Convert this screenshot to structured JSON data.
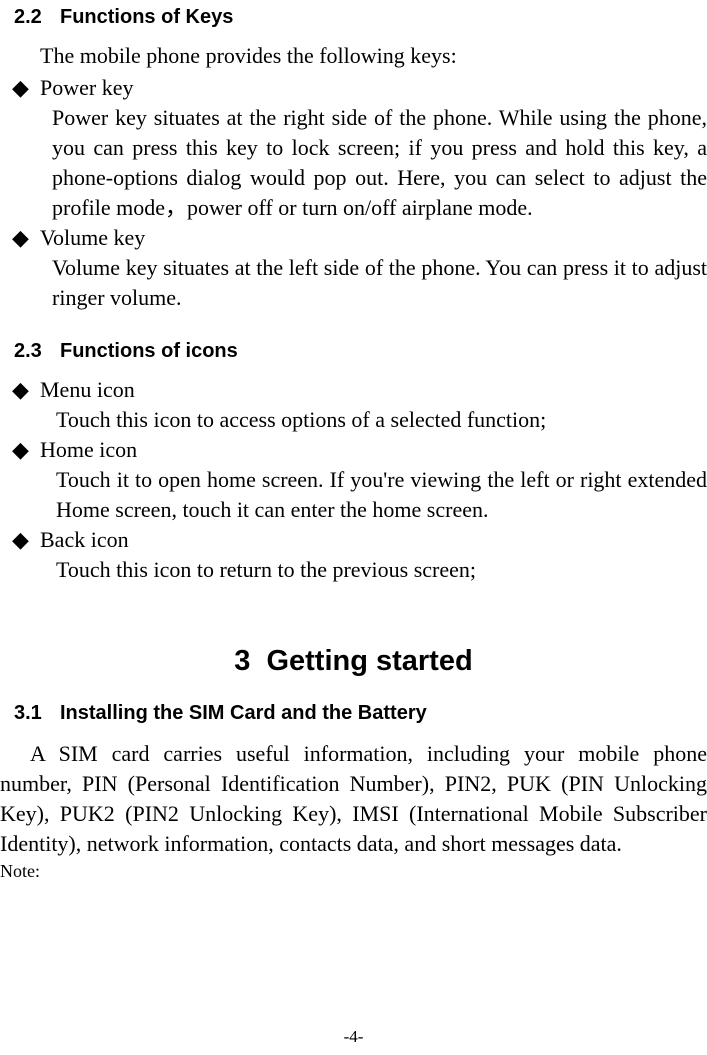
{
  "section22": {
    "num": "2.2",
    "title": "Functions of Keys",
    "intro": "The mobile phone provides the following keys:",
    "items": [
      {
        "title": "Power key",
        "body": "Power key situates at the right side of the phone. While using the phone, you can press this key to lock screen; if you press and hold this key, a phone-options dialog would pop out. Here, you can select to adjust the profile mode，power off or turn on/off airplane mode."
      },
      {
        "title": "Volume key",
        "body": "Volume key situates at the left side of the phone. You can press it to adjust ringer volume."
      }
    ]
  },
  "section23": {
    "num": "2.3",
    "title": "Functions of icons",
    "items": [
      {
        "title": "Menu icon",
        "body": "Touch this icon to access options of a selected function;"
      },
      {
        "title": "Home icon",
        "body": "Touch it to open home screen. If you're viewing the left or right extended Home screen, touch it can enter the home screen."
      },
      {
        "title": "Back icon",
        "body": "Touch this icon to return to the previous screen;"
      }
    ]
  },
  "chapter3": {
    "num": "3",
    "title": "Getting started"
  },
  "section31": {
    "num": "3.1",
    "title": "Installing the SIM Card and the Battery",
    "para": "A SIM card carries useful information, including your mobile phone number, PIN (Personal Identification Number), PIN2, PUK (PIN Unlocking Key), PUK2 (PIN2 Unlocking Key), IMSI (International Mobile Subscriber Identity), network information, contacts data, and short messages data.",
    "note": "Note:"
  },
  "pageNumber": "-4-"
}
